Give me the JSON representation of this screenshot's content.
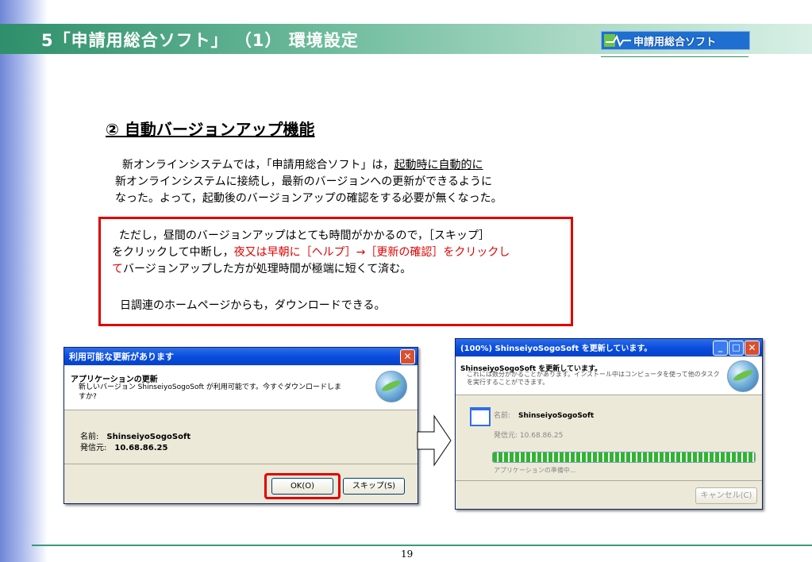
{
  "header": {
    "title": "5「申請用総合ソフト」 （1） 環境設定",
    "logo_text": "申請用総合ソフト"
  },
  "section": {
    "title": "② 自動バージョンアップ機能"
  },
  "paragraph": {
    "line1_pre": "新オンラインシステムでは，「申請用総合ソフト」は，",
    "line1_u": "起動時に自動的に",
    "line2": "新オンラインシステムに接続し，最新のバージョンへの更新ができるように",
    "line3": "なった。よって，起動後のバージョンアップの確認をする必要が無くなった。"
  },
  "notice": {
    "line1": "ただし，昼間のバージョンアップはとても時間がかかるので，［スキップ］",
    "line2_pre": "をクリックして中断し，",
    "line2_red": "夜又は早朝に［ヘルプ］→［更新の確認］をクリックし",
    "line3_red": "て",
    "line3_post": "バージョンアップした方が処理時間が極端に短くて済む。",
    "line4": "日調連のホームページからも，ダウンロードできる。"
  },
  "dialog_update": {
    "title": "利用可能な更新があります",
    "heading": "アプリケーションの更新",
    "message": "新しいバージョン ShinseiyoSogoSoft が利用可能です。今すぐダウンロードしますか?",
    "name_label": "名前:",
    "name_value": "ShinseiyoSogoSoft",
    "from_label": "発信元:",
    "from_value": "10.68.86.25",
    "ok_label": "OK(O)",
    "skip_label": "スキップ(S)"
  },
  "dialog_progress": {
    "title": "(100%) ShinseiyoSogoSoft を更新しています。",
    "heading": "ShinseiyoSogoSoft を更新しています。",
    "message": "これには数分かかることがあります。インストール中はコンピュータを使って他のタスクを実行することができます。",
    "name_label": "名前:",
    "name_value": "ShinseiyoSogoSoft",
    "from_label": "発信元:",
    "from_value": "10.68.86.25",
    "progress": 1.0,
    "status": "アプリケーションの準備中...",
    "cancel_label": "キャンセル(C)"
  },
  "footer": {
    "page_number": "19"
  },
  "colors": {
    "header_green": "#2f8f6b",
    "alert_red": "#e00000",
    "xp_blue": "#0a4ee0"
  }
}
